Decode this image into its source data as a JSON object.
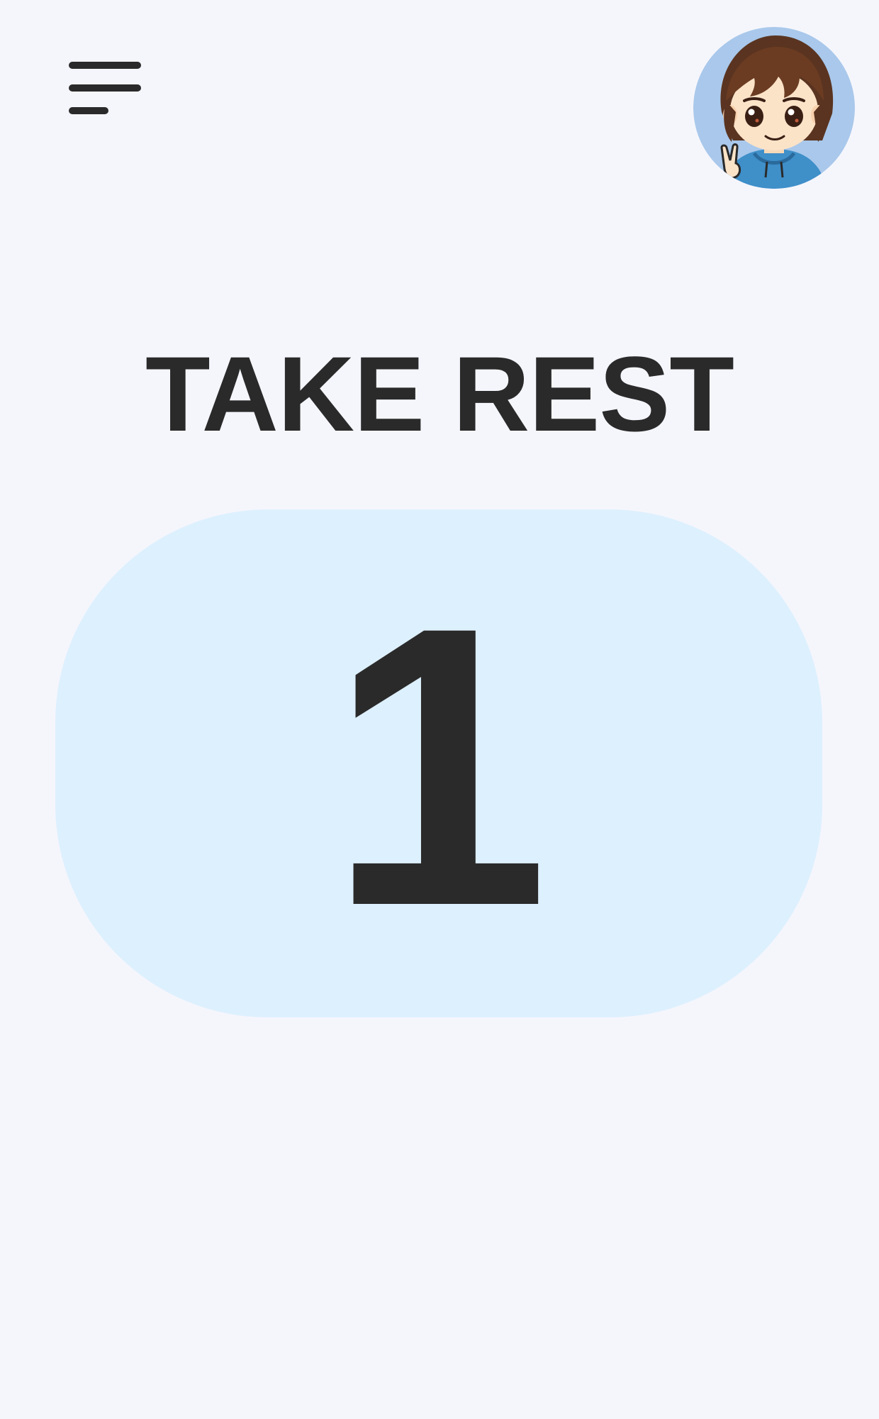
{
  "header": {
    "menu_icon": "hamburger-menu-icon",
    "avatar_icon": "user-avatar-cartoon"
  },
  "main": {
    "title": "TAKE REST",
    "counter": "1"
  },
  "colors": {
    "background": "#f5f6fc",
    "card": "#ddf0fe",
    "text": "#2a2a2a",
    "avatar_bg": "#a9c8eb"
  }
}
